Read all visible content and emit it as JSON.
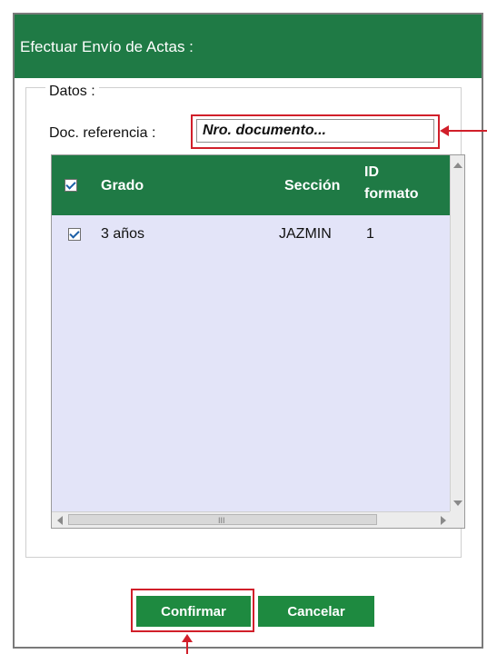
{
  "dialog": {
    "title": "Efectuar Envío de Actas :",
    "legend": "Datos :",
    "doc_ref_label": "Doc. referencia :",
    "doc_ref_placeholder": "Nro. documento..."
  },
  "grid": {
    "columns": [
      "Grado",
      "Sección",
      "ID",
      "formato"
    ],
    "header_checked": true,
    "rows": [
      {
        "checked": true,
        "grado": "3 años",
        "seccion": "JAZMIN",
        "id_formato": "1"
      }
    ],
    "hscroll_grip": "III"
  },
  "buttons": {
    "confirm": "Confirmar",
    "cancel": "Cancelar"
  },
  "colors": {
    "header_green": "#1f7a45",
    "button_green": "#1e8a40",
    "grid_bg": "#e3e4f8",
    "highlight_red": "#d11f2a"
  },
  "icons": {
    "checkbox": "checkbox-checked",
    "scroll_up": "triangle-up",
    "scroll_down": "triangle-down",
    "scroll_left": "triangle-left",
    "scroll_right": "triangle-right"
  }
}
